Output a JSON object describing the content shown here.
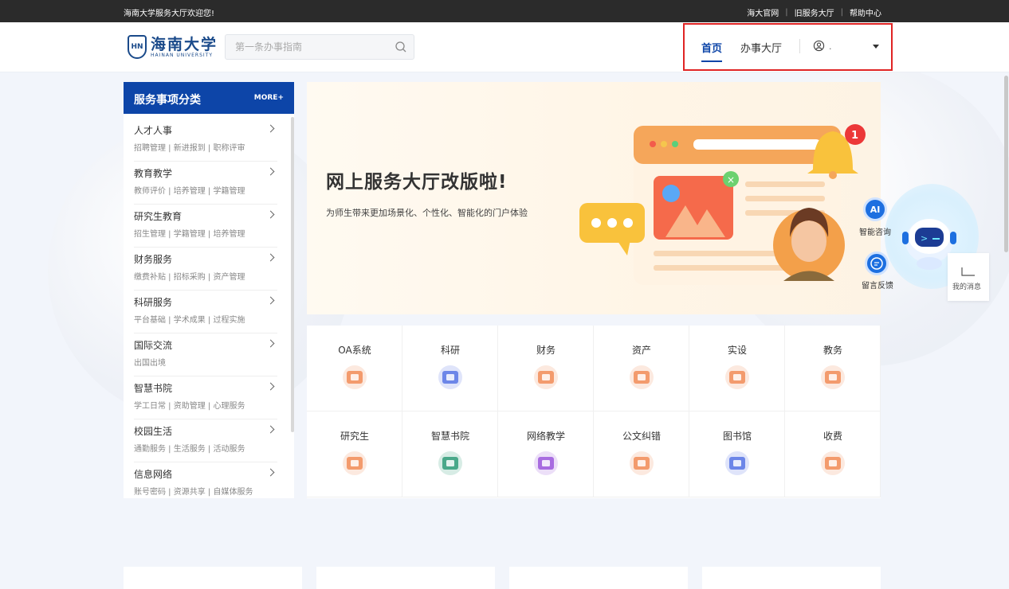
{
  "topbar": {
    "welcome": "海南大学服务大厅欢迎您!",
    "links": [
      "海大官网",
      "旧服务大厅",
      "帮助中心"
    ]
  },
  "header": {
    "logo_cn": "海南大学",
    "logo_en": "HAINAN UNIVERSITY",
    "logo_seal": "HN",
    "search_placeholder": "第一条办事指南",
    "nav": {
      "home": "首页",
      "hall": "办事大厅"
    },
    "user_name": "."
  },
  "sidebar": {
    "title": "服务事项分类",
    "more": "MORE+",
    "categories": [
      {
        "name": "人才人事",
        "subs": "招聘管理 | 新进报到 | 职称评审"
      },
      {
        "name": "教育教学",
        "subs": "教师评价 | 培养管理 | 学籍管理"
      },
      {
        "name": "研究生教育",
        "subs": "招生管理 | 学籍管理 | 培养管理"
      },
      {
        "name": "财务服务",
        "subs": "缴费补贴 | 招标采购 | 资产管理"
      },
      {
        "name": "科研服务",
        "subs": "平台基础 | 学术成果 | 过程实施"
      },
      {
        "name": "国际交流",
        "subs": "出国出境"
      },
      {
        "name": "智慧书院",
        "subs": "学工日常 | 资助管理 | 心理服务"
      },
      {
        "name": "校园生活",
        "subs": "通勤服务 | 生活服务 | 活动服务"
      },
      {
        "name": "信息网络",
        "subs": "账号密码 | 资源共享 | 自媒体服务"
      }
    ]
  },
  "banner": {
    "headline": "网上服务大厅改版啦!",
    "sub": "为师生带来更加场景化、个性化、智能化的门户体验",
    "badge": "1"
  },
  "grid": {
    "items": [
      {
        "label": "OA系统",
        "color": "#f39b6d"
      },
      {
        "label": "科研",
        "color": "#6c86e8"
      },
      {
        "label": "财务",
        "color": "#f39b6d"
      },
      {
        "label": "资产",
        "color": "#f39b6d"
      },
      {
        "label": "实设",
        "color": "#f39b6d"
      },
      {
        "label": "教务",
        "color": "#f39b6d"
      },
      {
        "label": "研究生",
        "color": "#f39b6d"
      },
      {
        "label": "智慧书院",
        "color": "#4aa88a"
      },
      {
        "label": "网络教学",
        "color": "#a86ce0"
      },
      {
        "label": "公文纠错",
        "color": "#f39b6d"
      },
      {
        "label": "图书馆",
        "color": "#6c86e8"
      },
      {
        "label": "收费",
        "color": "#f39b6d"
      }
    ]
  },
  "float": {
    "ai_btn": "AI",
    "ai_label": "智能咨询",
    "feedback_label": "留言反馈",
    "messages_label": "我的消息"
  },
  "colors": {
    "brand": "#0d45a8",
    "highlight": "#e02424",
    "topbar": "#2b2b2b"
  }
}
